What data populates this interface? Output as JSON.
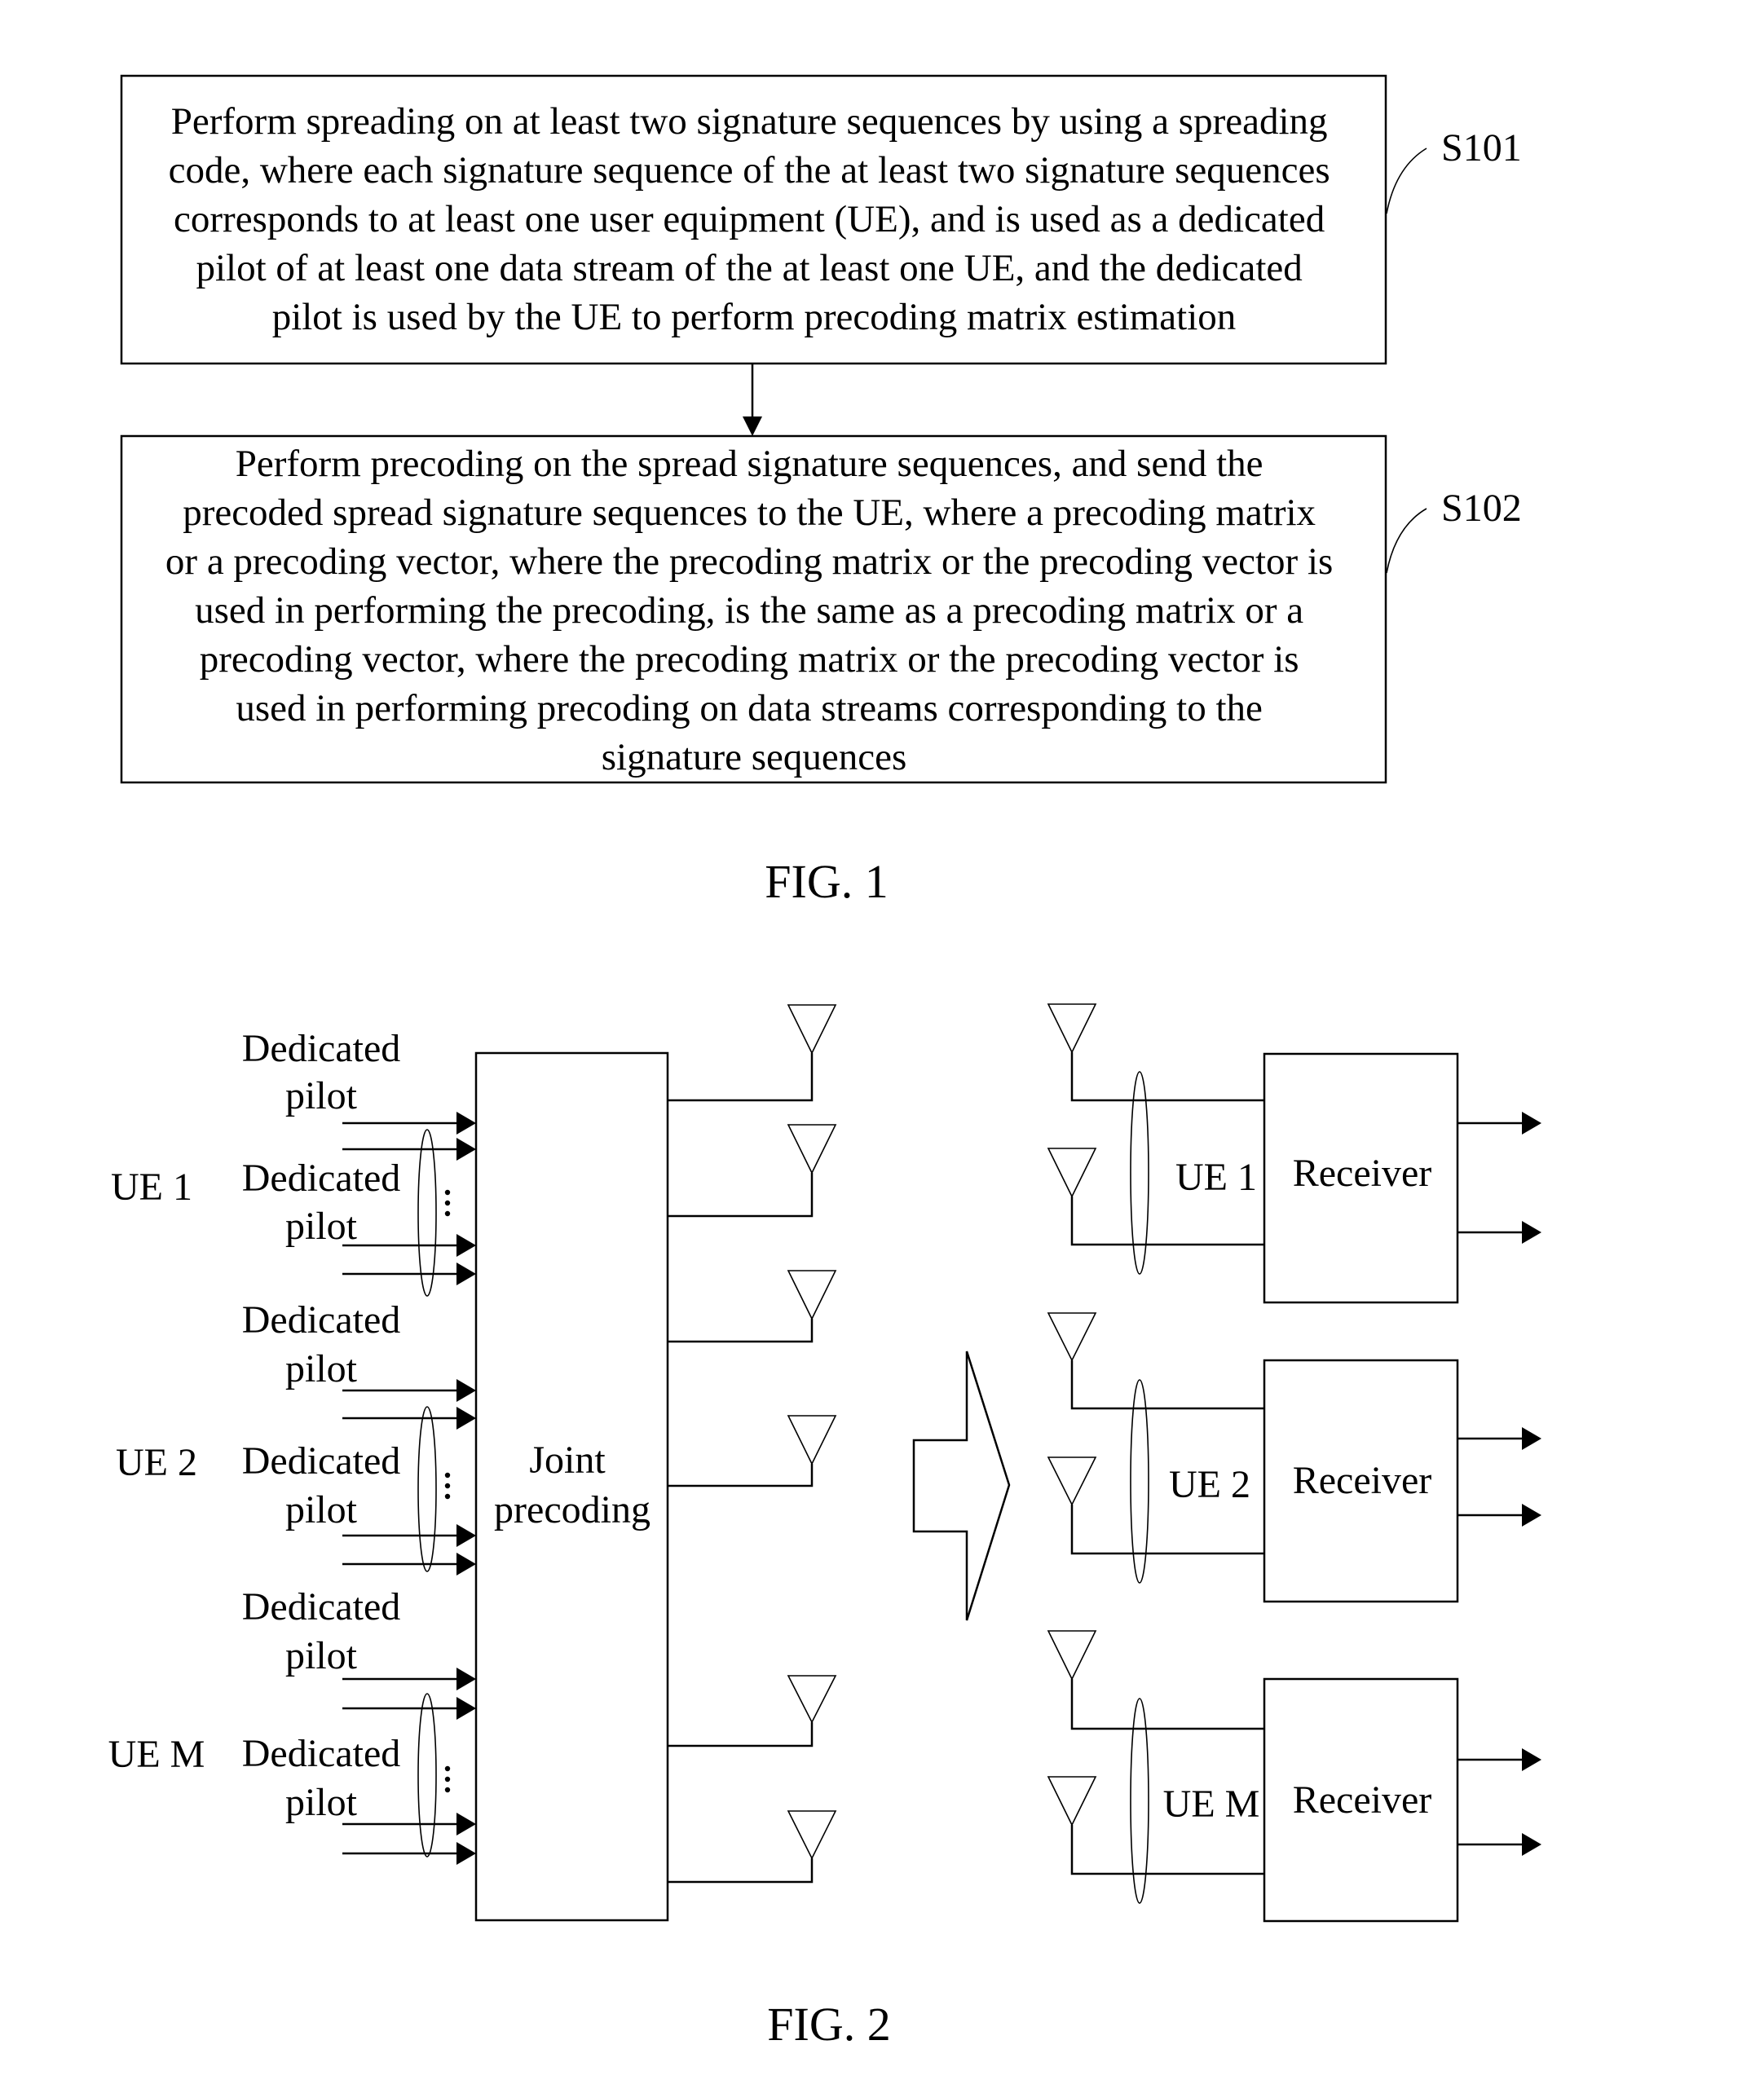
{
  "fig1": {
    "step1": {
      "id": "S101",
      "lines": [
        "Perform spreading on at least two signature sequences by using a spreading",
        "code, where each signature sequence of the at least two signature sequences",
        "corresponds to at least one user equipment (UE), and is used as a dedicated",
        "pilot of at least one data stream of the at least one UE, and the dedicated",
        "pilot is used by the UE to perform precoding matrix estimation"
      ]
    },
    "step2": {
      "id": "S102",
      "lines": [
        "Perform precoding on the spread signature sequences, and send the",
        "precoded spread signature sequences to the UE, where a precoding matrix",
        "or a precoding vector, where the precoding matrix or the precoding vector is",
        "used in performing the precoding, is the same as a precoding matrix or a",
        "precoding vector, where the precoding matrix or the precoding vector is",
        "used in performing precoding on data streams corresponding to the",
        "signature sequences"
      ]
    },
    "caption": "FIG. 1"
  },
  "fig2": {
    "pilot_word1": "Dedicated",
    "pilot_word2": "pilot",
    "ue_groups": [
      {
        "label": "UE 1"
      },
      {
        "label": "UE 2"
      },
      {
        "label": "UE M"
      }
    ],
    "joint_line1": "Joint",
    "joint_line2": "precoding",
    "receivers": [
      {
        "ue_label": "UE 1",
        "label": "Receiver"
      },
      {
        "ue_label": "UE 2",
        "label": "Receiver"
      },
      {
        "ue_label": "UE M",
        "label": "Receiver"
      }
    ],
    "dots": "⋮",
    "caption": "FIG. 2"
  }
}
